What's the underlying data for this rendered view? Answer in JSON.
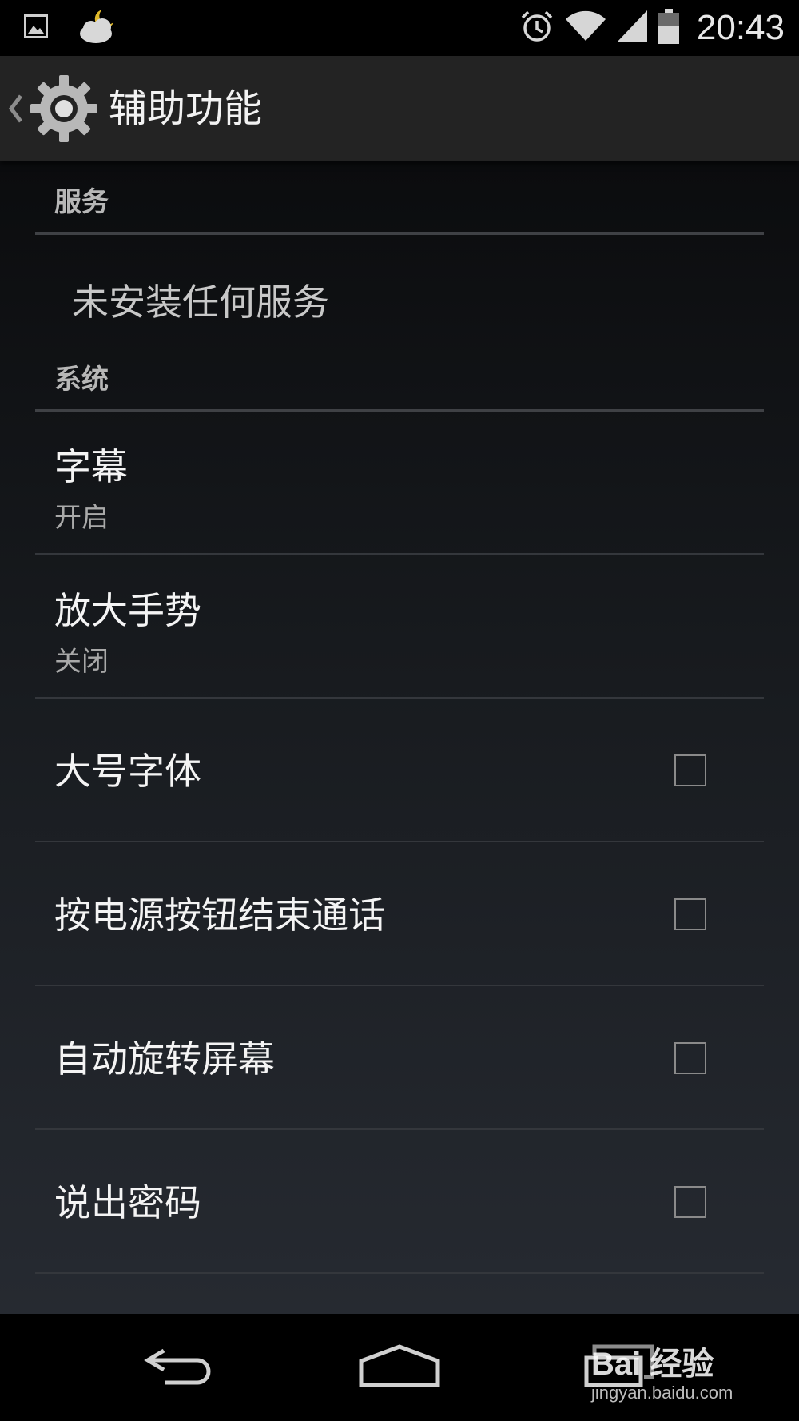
{
  "status_bar": {
    "time": "20:43",
    "icons": [
      "image-notification-icon",
      "weather-icon",
      "alarm-icon",
      "wifi-icon",
      "signal-icon",
      "battery-icon"
    ]
  },
  "action_bar": {
    "title": "辅助功能"
  },
  "sections": {
    "services": {
      "header": "服务",
      "empty_text": "未安装任何服务"
    },
    "system": {
      "header": "系统",
      "items": [
        {
          "title": "字幕",
          "summary": "开启",
          "type": "link"
        },
        {
          "title": "放大手势",
          "summary": "关闭",
          "type": "link"
        },
        {
          "title": "大号字体",
          "checked": false,
          "type": "checkbox"
        },
        {
          "title": "按电源按钮结束通话",
          "checked": false,
          "type": "checkbox"
        },
        {
          "title": "自动旋转屏幕",
          "checked": false,
          "type": "checkbox"
        },
        {
          "title": "说出密码",
          "checked": false,
          "type": "checkbox"
        }
      ]
    }
  },
  "watermark": {
    "brand": "Bai 经验",
    "url": "jingyan.baidu.com"
  },
  "colors": {
    "action_bar": "#232323",
    "divider": "#3f4145",
    "text_primary": "#f4f4f4",
    "text_secondary": "#a9a9a9"
  }
}
